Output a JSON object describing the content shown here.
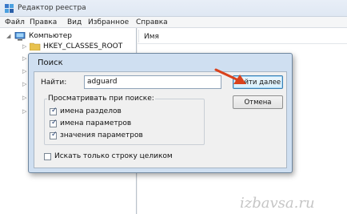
{
  "window": {
    "title": "Редактор реестра"
  },
  "menu": [
    "Файл",
    "Правка",
    "Вид",
    "Избранное",
    "Справка"
  ],
  "tree": {
    "root": "Компьютер",
    "child": "HKEY_CLASSES_ROOT"
  },
  "list": {
    "column_name": "Имя"
  },
  "dialog": {
    "title": "Поиск",
    "find_label": "Найти:",
    "find_value": "adguard",
    "find_next_label": "Найти далее",
    "cancel_label": "Отмена",
    "search_group_label": "Просматривать при поиске:",
    "options": [
      {
        "label": "имена разделов",
        "checked": true
      },
      {
        "label": "имена параметров",
        "checked": true
      },
      {
        "label": "значения параметров",
        "checked": true
      }
    ],
    "match_whole": {
      "label": "Искать только строку целиком",
      "checked": false
    }
  },
  "watermark": "izbavsa.ru",
  "colors": {
    "arrow": "#d9421c",
    "dialog_frame": "#cfdff1",
    "focus_button_border": "#3c7fb1"
  }
}
